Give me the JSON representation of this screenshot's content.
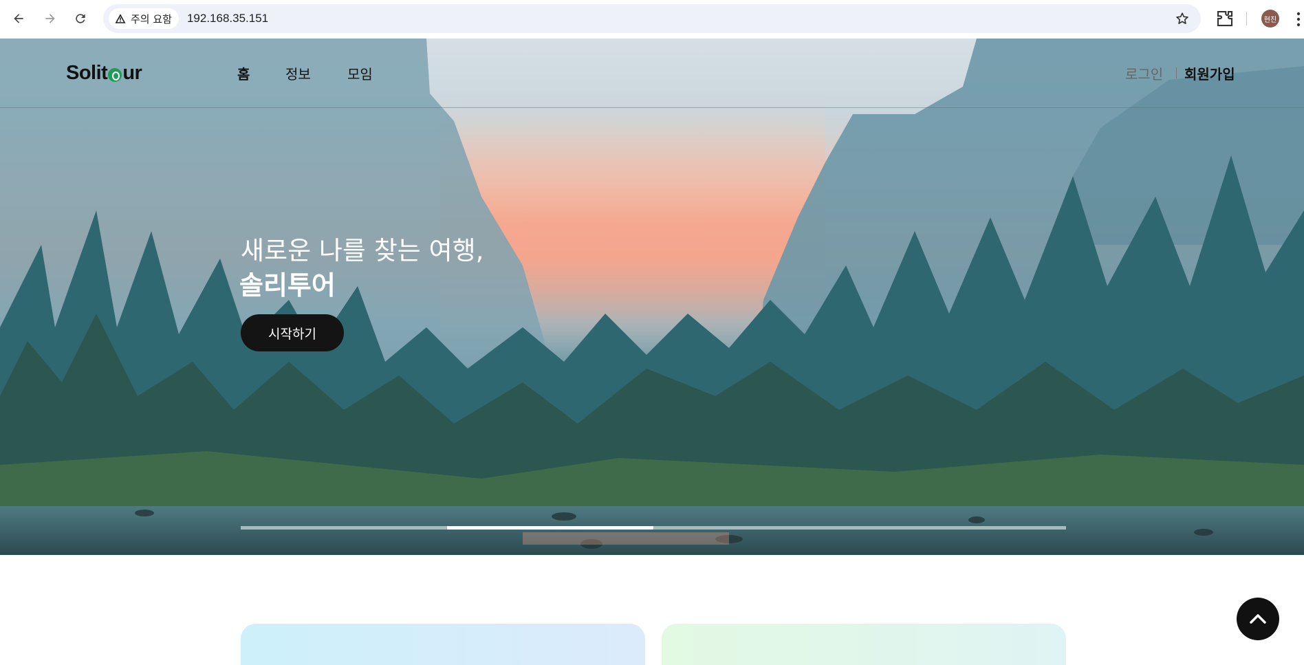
{
  "browser": {
    "security_chip": "주의 요함",
    "url": "192.168.35.151",
    "profile_initials": "현진",
    "icons": [
      "back-arrow-icon",
      "forward-arrow-icon",
      "reload-icon",
      "warning-icon",
      "star-icon",
      "extensions-icon",
      "kebab-menu-icon"
    ]
  },
  "site": {
    "logo": {
      "before": "Solit",
      "after": "ur"
    },
    "nav": [
      {
        "label": "홈",
        "active": true
      },
      {
        "label": "정보",
        "active": false
      },
      {
        "label": "모임",
        "active": false
      }
    ],
    "auth": {
      "login": "로그인",
      "signup": "회원가입"
    }
  },
  "hero": {
    "headline_line1": "새로운 나를 찾는 여행,",
    "headline_line2": "솔리투어",
    "cta": "시작하기",
    "slider_progress": {
      "start": 0.25,
      "end": 0.5
    }
  },
  "colors": {
    "brand_green": "#1f9d58",
    "button_dark": "#141414",
    "card_left": "#cdf0fb",
    "card_right": "#e2f9e2"
  }
}
